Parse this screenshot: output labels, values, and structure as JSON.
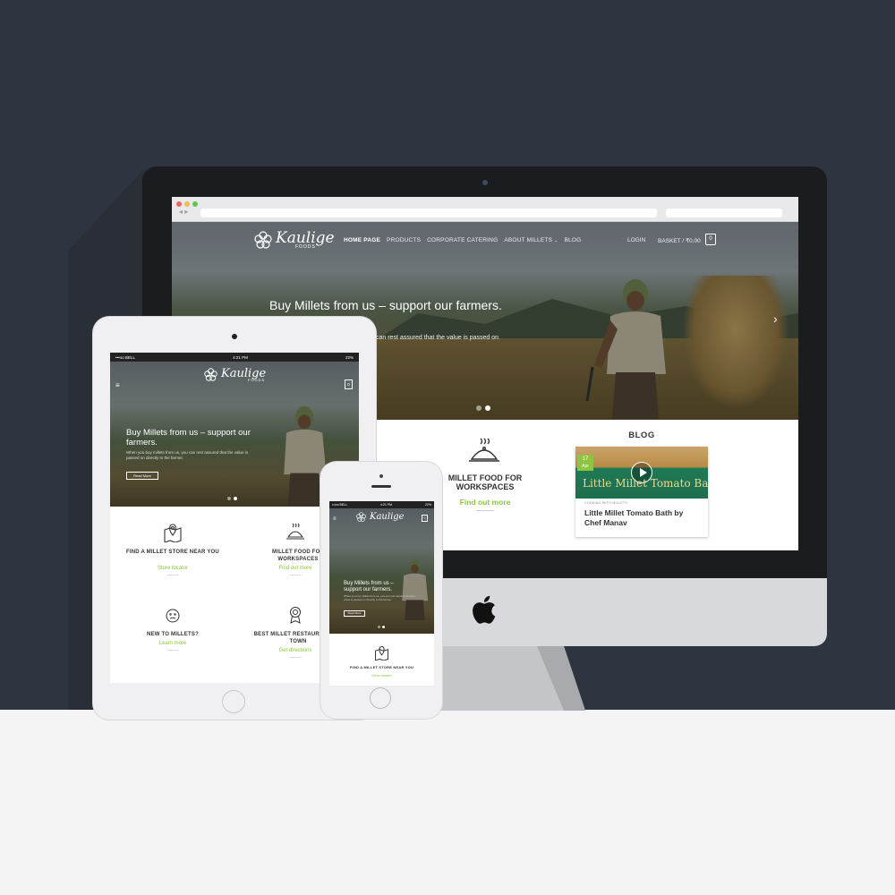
{
  "colors": {
    "background": "#2f3540",
    "accent": "#8cc540",
    "floor": "#f4f4f4"
  },
  "brand": {
    "name": "Kaulige",
    "sub": "FOODS"
  },
  "desktop": {
    "nav": [
      "HOME PAGE",
      "PRODUCTS",
      "CORPORATE CATERING",
      "ABOUT MILLETS",
      "BLOG"
    ],
    "nav_dropdown_icon": "chevron-down-icon",
    "login": "LOGIN",
    "basket": "BASKET / ₹0.00",
    "basket_count": "0",
    "hero_title": "Buy Millets from us – support our farmers.",
    "hero_text": "can rest assured that the value is passed on",
    "feature_title": "MILLET FOOD FOR WORKSPACES",
    "feature_link": "Find out more",
    "blog_heading": "BLOG",
    "blog_post": {
      "date_day": "17",
      "date_month": "Apr",
      "image_title": "Little Millet Tomato Bath",
      "category": "COOKING WITH MILLETS",
      "title": "Little Millet Tomato Bath by Chef Manav"
    }
  },
  "tablet": {
    "status_left": "•••oo BELL",
    "status_time": "4:21 PM",
    "status_right": "22%",
    "basket_count": "0",
    "hero_title": "Buy Millets from us – support our farmers.",
    "hero_text": "When you buy millets from us, you can rest assured that the value is passed on directly to the farmer.",
    "hero_button": "Read More",
    "features": [
      {
        "title": "FIND A MILLET STORE NEAR YOU",
        "link": "Store locator",
        "icon": "map-pin-icon"
      },
      {
        "title": "MILLET FOOD FOR WORKSPACES",
        "link": "Find out more",
        "icon": "food-tray-icon"
      },
      {
        "title": "NEW TO MILLETS?",
        "link": "Learn more",
        "icon": "smiley-icon"
      },
      {
        "title": "BEST MILLET RESTAURANTS IN TOWN",
        "link": "Get directions",
        "icon": "award-icon"
      }
    ]
  },
  "phone": {
    "status_left": "•••oo BELL",
    "status_time": "4:21 PM",
    "status_right": "22%",
    "basket_count": "0",
    "hero_title": "Buy Millets from us – support our farmers.",
    "hero_text": "When you buy millets from us, you can rest assured that the value is passed on directly to the farmer.",
    "hero_button": "Read More",
    "feature_title": "FIND A MILLET STORE NEAR YOU",
    "feature_link": "Store locator"
  }
}
